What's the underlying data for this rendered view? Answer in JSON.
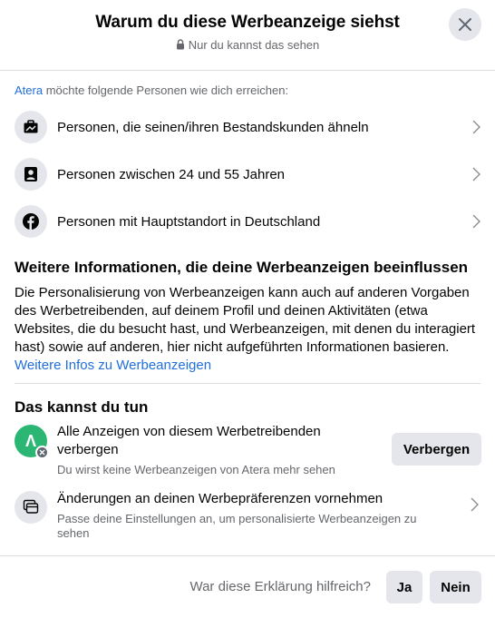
{
  "header": {
    "title": "Warum du diese Werbeanzeige siehst",
    "subtitle": "Nur du kannst das sehen"
  },
  "intro": {
    "advertiser": "Atera",
    "text": " möchte folgende Personen wie dich erreichen:"
  },
  "targeting": [
    {
      "icon": "briefcase-icon",
      "label": "Personen, die seinen/ihren Bestandskunden ähneln"
    },
    {
      "icon": "profile-icon",
      "label": "Personen zwischen 24 und 55 Jahren"
    },
    {
      "icon": "facebook-icon",
      "label": "Personen mit Hauptstandort in Deutschland"
    }
  ],
  "more_info": {
    "title": "Weitere Informationen, die deine Werbeanzeigen beeinflussen",
    "text": "Die Personalisierung von Werbeanzeigen kann auch auf anderen Vorgaben des Werbetreibenden, auf deinem Profil und deinen Aktivitäten (etwa Websites, die du besucht hast, und Werbeanzeigen, mit denen du interagiert hast) sowie auf anderen, hier nicht aufgeführten Informationen basieren. ",
    "link": "Weitere Infos zu Werbeanzeigen"
  },
  "actions": {
    "title": "Das kannst du tun",
    "hide": {
      "line1": "Alle Anzeigen von diesem Werbetreibenden",
      "line2": "verbergen",
      "sub": "Du wirst keine Werbeanzeigen von Atera mehr sehen",
      "button": "Verbergen",
      "avatar_letter": "Λ",
      "avatar_color": "#2bb673"
    },
    "prefs": {
      "title": "Änderungen an deinen Werbepräferenzen vornehmen",
      "sub_line1": "Passe deine Einstellungen an, um personalisierte Werbeanzeigen zu",
      "sub_line2": "sehen"
    }
  },
  "footer": {
    "question": "War diese Erklärung hilfreich?",
    "yes": "Ja",
    "no": "Nein"
  }
}
